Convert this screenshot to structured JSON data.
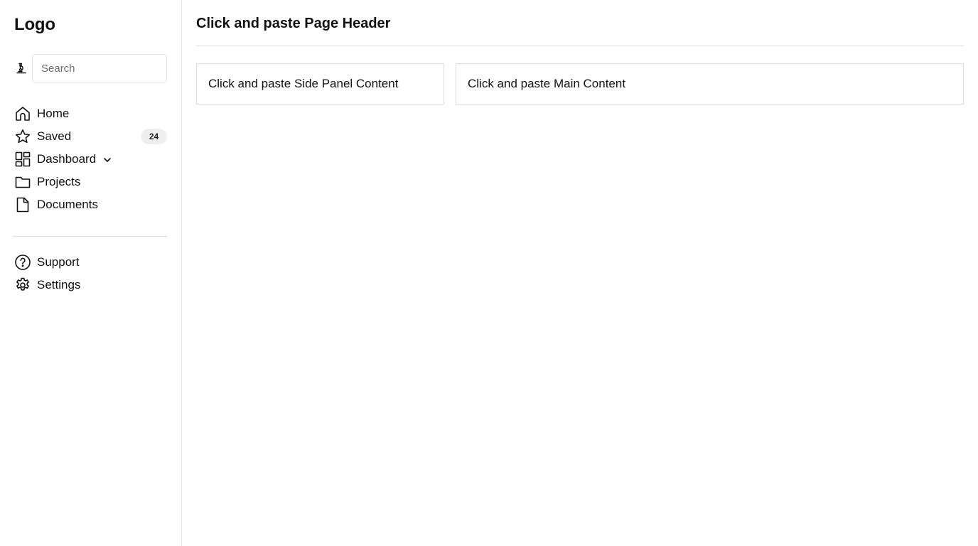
{
  "sidebar": {
    "logo": "Logo",
    "search": {
      "placeholder": "Search",
      "value": "",
      "icon": "microscope-icon"
    },
    "nav": [
      {
        "label": "Home",
        "icon": "home-icon"
      },
      {
        "label": "Saved",
        "icon": "star-icon",
        "badge": "24"
      },
      {
        "label": "Dashboard",
        "icon": "dashboard-icon",
        "has_dropdown": true
      },
      {
        "label": "Projects",
        "icon": "folder-icon"
      },
      {
        "label": "Documents",
        "icon": "document-icon"
      }
    ],
    "footer_nav": [
      {
        "label": "Support",
        "icon": "help-circle-icon"
      },
      {
        "label": "Settings",
        "icon": "gear-icon"
      }
    ]
  },
  "header": {
    "title": "Click and paste Page Header"
  },
  "content": {
    "side_panel": "Click and paste Side Panel Content",
    "main_panel": "Click and paste Main Content"
  },
  "colors": {
    "border": "#e6e6e6",
    "badge_bg": "#efefef",
    "text": "#111111"
  }
}
